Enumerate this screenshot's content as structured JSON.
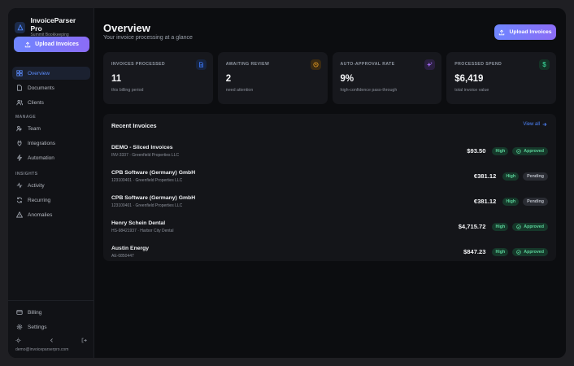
{
  "brand": {
    "name": "InvoiceParser Pro",
    "org": "Summit Bookkeeping"
  },
  "sidebar": {
    "upload_label": "Upload Invoices",
    "main_items": [
      {
        "label": "Overview",
        "icon": "grid-icon",
        "active": true
      },
      {
        "label": "Documents",
        "icon": "document-icon"
      },
      {
        "label": "Clients",
        "icon": "users-icon"
      }
    ],
    "manage_title": "MANAGE",
    "manage_items": [
      {
        "label": "Team",
        "icon": "team-icon"
      },
      {
        "label": "Integrations",
        "icon": "plug-icon"
      },
      {
        "label": "Automation",
        "icon": "automation-icon"
      }
    ],
    "insights_title": "INSIGHTS",
    "insights_items": [
      {
        "label": "Activity",
        "icon": "activity-icon"
      },
      {
        "label": "Recurring",
        "icon": "recurring-icon"
      },
      {
        "label": "Anomalies",
        "icon": "warning-icon"
      }
    ],
    "bottom_items": [
      {
        "label": "Billing",
        "icon": "card-icon"
      },
      {
        "label": "Settings",
        "icon": "gear-icon"
      }
    ],
    "user_email": "demo@invoiceparserpro.com"
  },
  "header": {
    "title": "Overview",
    "subtitle": "Your invoice processing at a glance",
    "upload_label": "Upload Invoices"
  },
  "stats": [
    {
      "label": "INVOICES PROCESSED",
      "value": "11",
      "hint": "this billing period",
      "icon": "document-icon",
      "color": "#3f7bff",
      "bg": "#17243f"
    },
    {
      "label": "AWAITING REVIEW",
      "value": "2",
      "hint": "need attention",
      "icon": "clock-icon",
      "color": "#f5a524",
      "bg": "#3a2a12"
    },
    {
      "label": "AUTO-APPROVAL RATE",
      "value": "9%",
      "hint": "high-confidence pass-through",
      "icon": "sparkle-icon",
      "color": "#a56cf5",
      "bg": "#2a1f3f"
    },
    {
      "label": "PROCESSED SPEND",
      "value": "$6,419",
      "hint": "total invoice value",
      "icon": "dollar-icon",
      "color": "#33c28a",
      "bg": "#143226"
    }
  ],
  "recent": {
    "title": "Recent Invoices",
    "view_all": "View all",
    "rows": [
      {
        "vendor": "DEMO - Sliced Invoices",
        "ref": "INV-3337 · Greenfield Properties LLC",
        "amount": "$93.50",
        "confidence": "High",
        "status": "Approved"
      },
      {
        "vendor": "CPB Software (Germany) GmbH",
        "ref": "123100401 · Greenfield Properties LLC",
        "amount": "€381.12",
        "confidence": "High",
        "status": "Pending"
      },
      {
        "vendor": "CPB Software (Germany) GmbH",
        "ref": "123100401 · Greenfield Properties LLC",
        "amount": "€381.12",
        "confidence": "High",
        "status": "Pending"
      },
      {
        "vendor": "Henry Schein Dental",
        "ref": "HS-98421937 · Harbor City Dental",
        "amount": "$4,715.72",
        "confidence": "High",
        "status": "Approved"
      },
      {
        "vendor": "Austin Energy",
        "ref": "AE-0850447",
        "amount": "$847.23",
        "confidence": "High",
        "status": "Approved"
      }
    ]
  }
}
